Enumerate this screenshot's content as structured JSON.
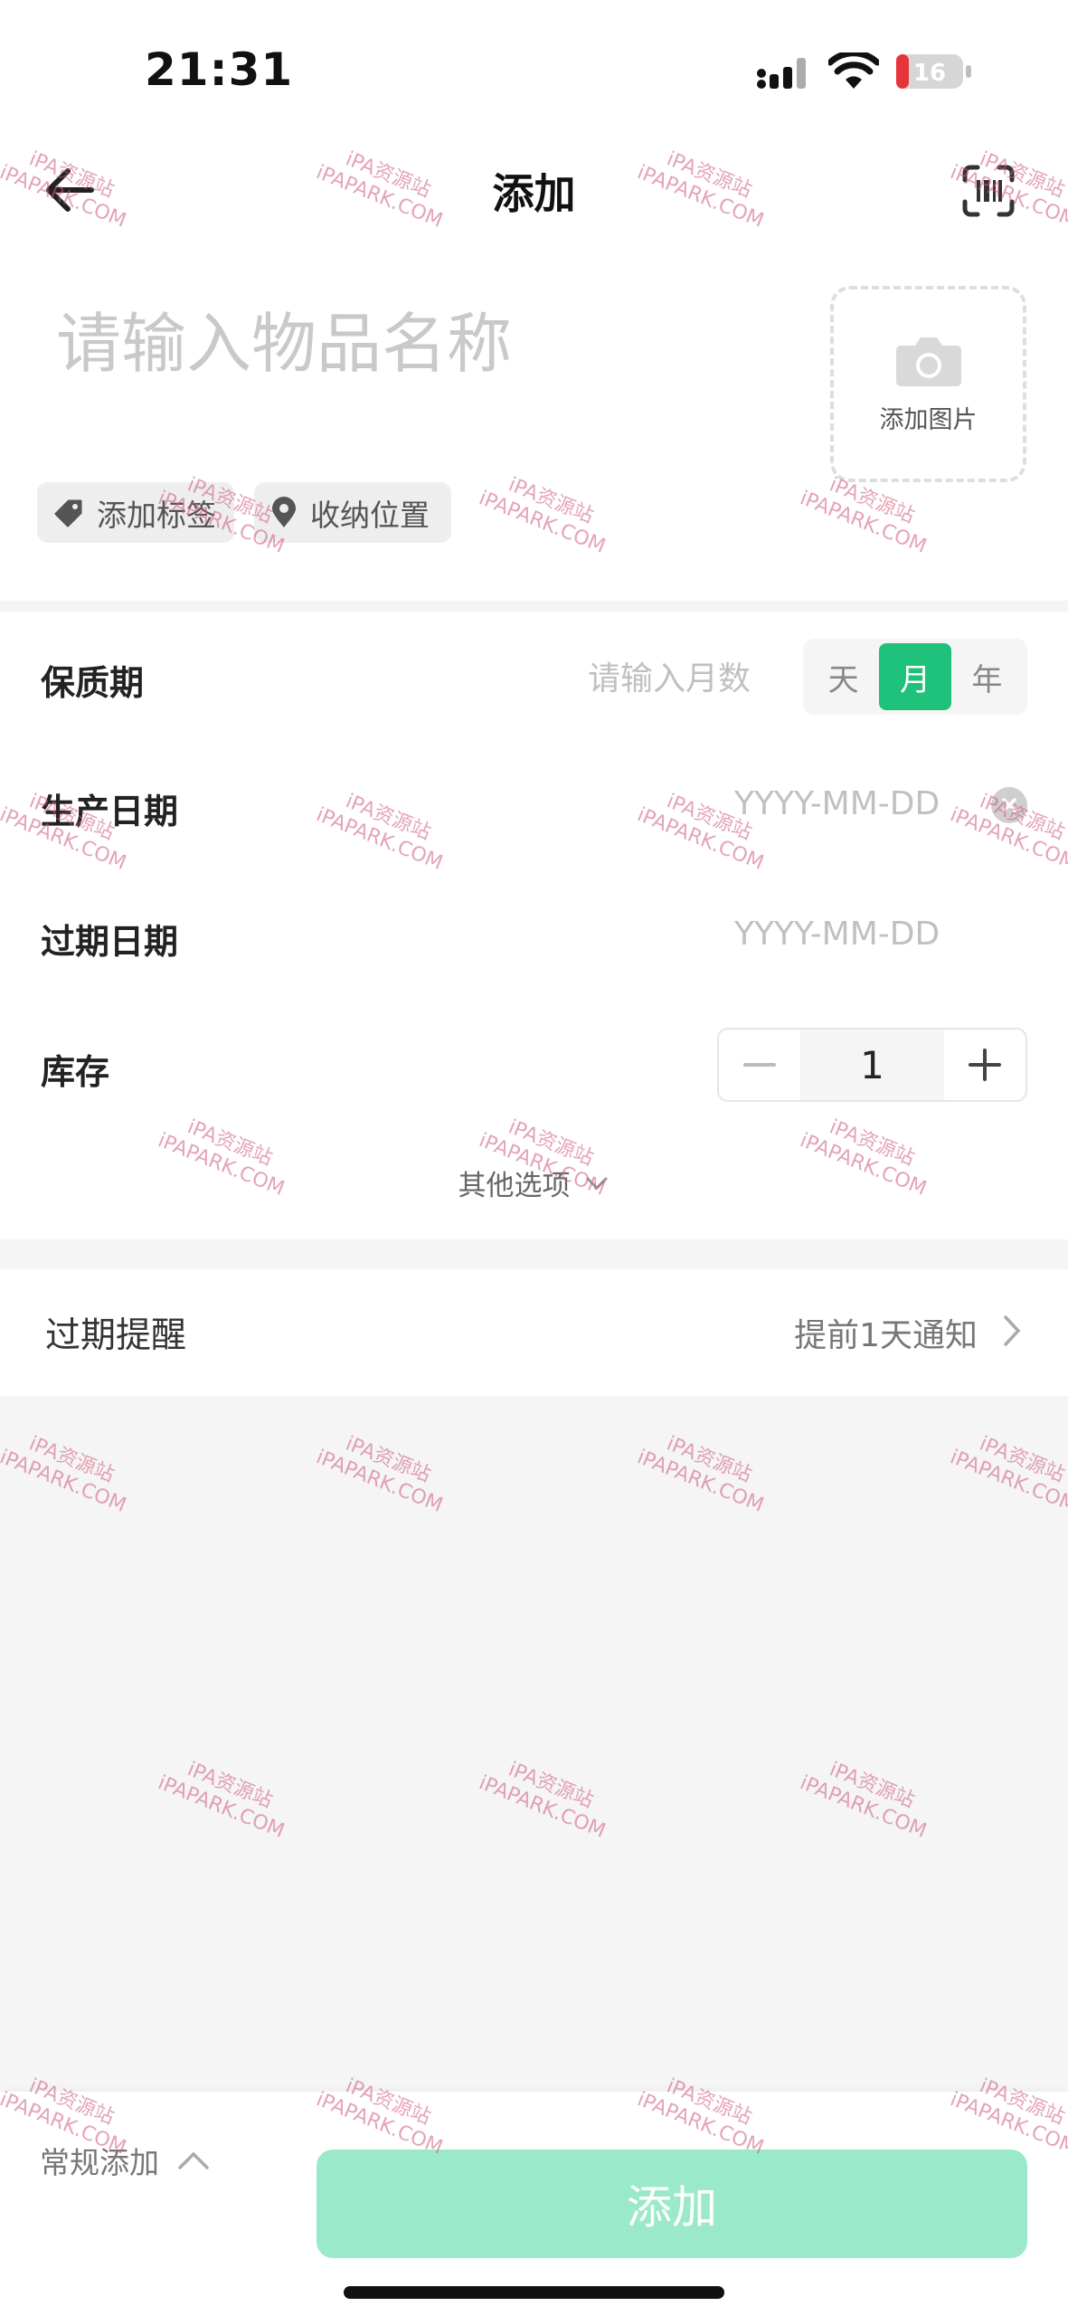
{
  "status_bar": {
    "time": "21:31",
    "battery": "16"
  },
  "nav": {
    "title": "添加"
  },
  "item": {
    "name_placeholder": "请输入物品名称",
    "add_image_label": "添加图片",
    "tag_chip_label": "添加标签",
    "location_chip_label": "收纳位置"
  },
  "form": {
    "shelf_life": {
      "label": "保质期",
      "placeholder": "请输入月数",
      "units": [
        "天",
        "月",
        "年"
      ],
      "selected_unit": "月"
    },
    "production_date": {
      "label": "生产日期",
      "placeholder": "YYYY-MM-DD"
    },
    "expiry_date": {
      "label": "过期日期",
      "placeholder": "YYYY-MM-DD"
    },
    "stock": {
      "label": "库存",
      "value": "1"
    },
    "more_options": "其他选项"
  },
  "reminder": {
    "label": "过期提醒",
    "value": "提前1天通知"
  },
  "bottom": {
    "mode_label": "常规添加",
    "add_button": "添加"
  },
  "watermark": {
    "line1": "iPA资源站",
    "line2": "iPAPARK.COM"
  },
  "colors": {
    "accent": "#1ec27a",
    "add_button_bg": "#9ae9cb",
    "band": "#f5f5f5"
  }
}
